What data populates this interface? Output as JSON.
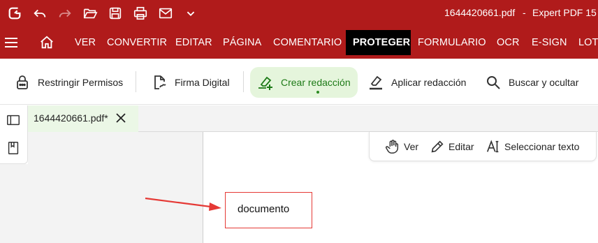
{
  "window": {
    "file_title": "1644420661.pdf",
    "separator": "-",
    "app_title": "Expert PDF 15",
    "colors": {
      "brand": "#b01b1b",
      "active_tab": "#000000",
      "active_tool": "#1d7a17",
      "annotation": "#e53935"
    }
  },
  "titlebar_icons": [
    "app-logo-icon",
    "undo-icon",
    "redo-icon",
    "open-folder-icon",
    "save-icon",
    "print-icon",
    "email-icon",
    "chevron-down-icon"
  ],
  "menu": {
    "tabs": [
      {
        "label": "VER"
      },
      {
        "label": "CONVERTIR"
      },
      {
        "label": "EDITAR"
      },
      {
        "label": "PÁGINA"
      },
      {
        "label": "COMENTARIO"
      },
      {
        "label": "PROTEGER",
        "active": true
      },
      {
        "label": "FORMULARIO"
      },
      {
        "label": "OCR"
      },
      {
        "label": "E-SIGN"
      },
      {
        "label": "LOTE"
      }
    ]
  },
  "ribbon": {
    "restrict": "Restringir Permisos",
    "sign": "Firma Digital",
    "create_redaction": "Crear redacción",
    "apply_redaction": "Aplicar redacción",
    "search_hide": "Buscar y ocultar"
  },
  "document_tab": {
    "label": "1644420661.pdf*"
  },
  "float_tools": {
    "view": "Ver",
    "edit": "Editar",
    "select_text": "Seleccionar texto"
  },
  "document": {
    "word": "documento"
  }
}
